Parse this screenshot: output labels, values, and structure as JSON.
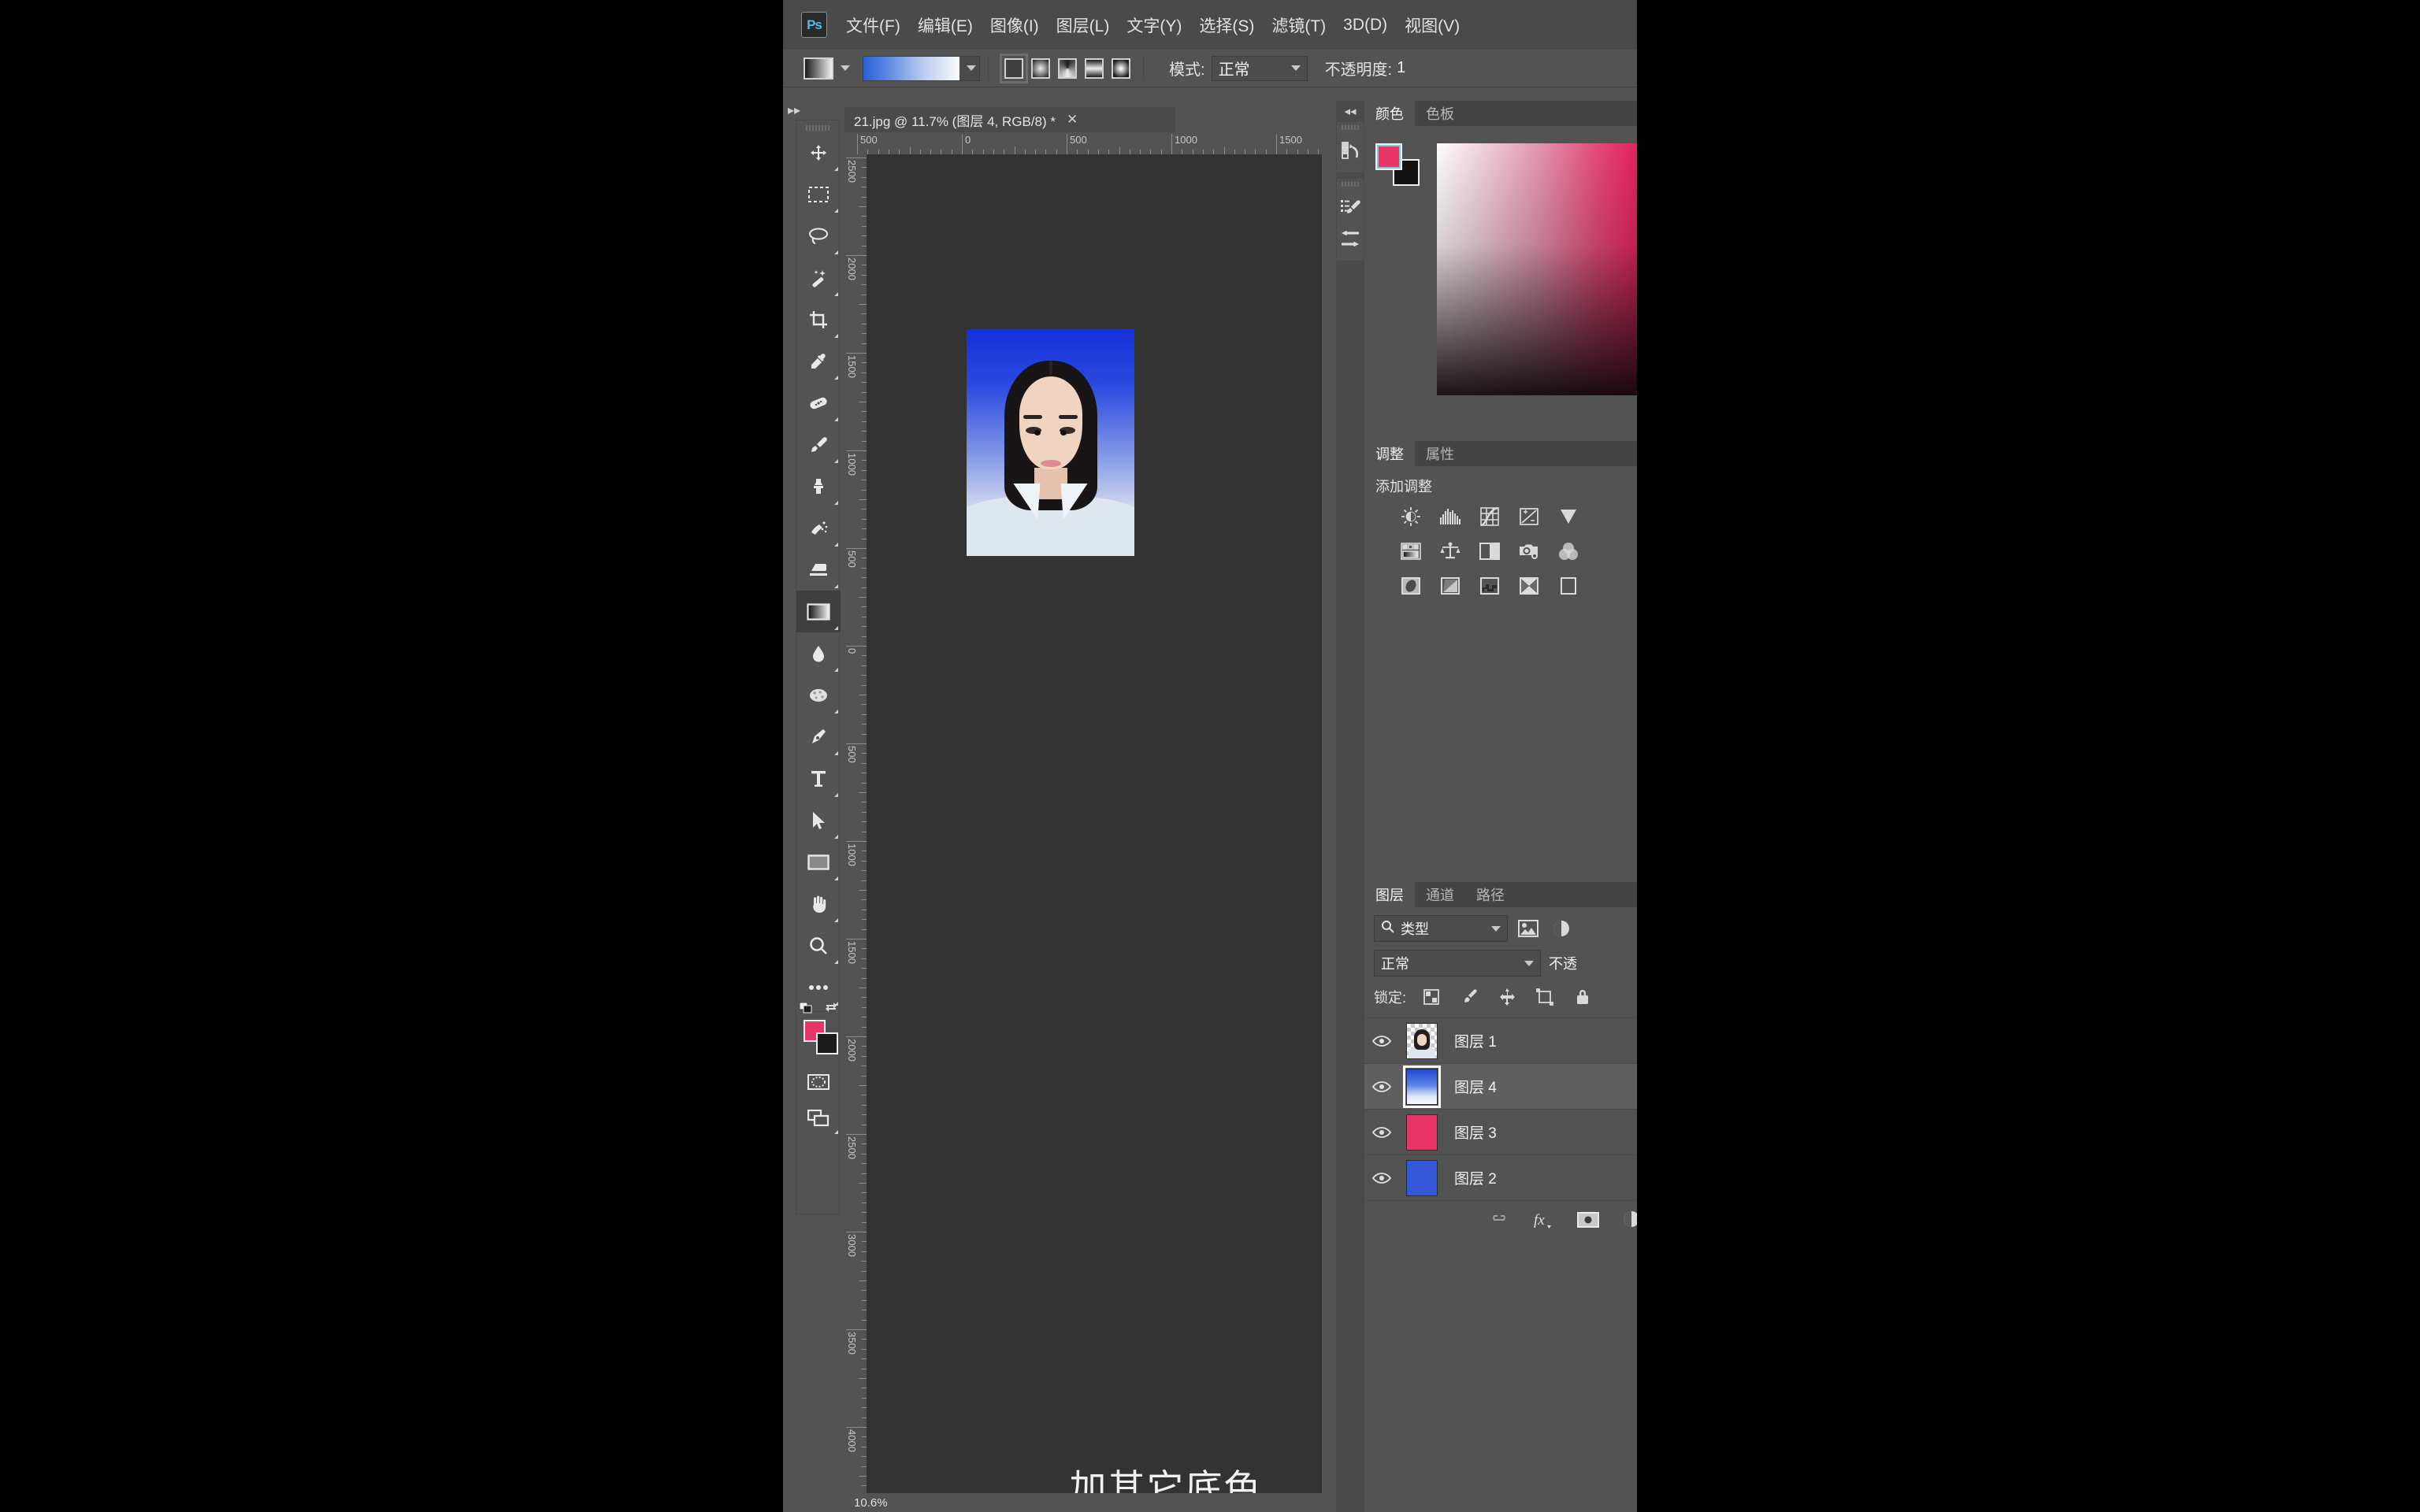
{
  "app": {
    "logo": "Ps",
    "accent": "#57b9ea"
  },
  "menu": {
    "items": [
      {
        "label": "文件(F)"
      },
      {
        "label": "编辑(E)"
      },
      {
        "label": "图像(I)"
      },
      {
        "label": "图层(L)"
      },
      {
        "label": "文字(Y)"
      },
      {
        "label": "选择(S)"
      },
      {
        "label": "滤镜(T)"
      },
      {
        "label": "3D(D)"
      },
      {
        "label": "视图(V)"
      }
    ]
  },
  "options_bar": {
    "gradient_preset_icon": "gradient-preset-swatch",
    "gradient_swatch_icon": "blue-to-white-gradient",
    "gradient_types": [
      {
        "name": "linear-gradient-type",
        "selected": true
      },
      {
        "name": "radial-gradient-type",
        "selected": false
      },
      {
        "name": "angle-gradient-type",
        "selected": false
      },
      {
        "name": "reflected-gradient-type",
        "selected": false
      },
      {
        "name": "diamond-gradient-type",
        "selected": false
      }
    ],
    "mode_label": "模式:",
    "mode_value": "正常",
    "opacity_label": "不透明度:",
    "opacity_value": "1"
  },
  "left_dock": {
    "collapse_icon": "expand-right-double-chevron"
  },
  "toolbox": {
    "tools": [
      {
        "name": "move-tool",
        "label": "移动工具"
      },
      {
        "name": "rectangular-marquee-tool",
        "label": "矩形选框工具"
      },
      {
        "name": "lasso-tool",
        "label": "套索工具"
      },
      {
        "name": "magic-wand-tool",
        "label": "快速选择工具"
      },
      {
        "name": "crop-tool",
        "label": "裁剪工具"
      },
      {
        "name": "eyedropper-tool",
        "label": "吸管工具"
      },
      {
        "name": "spot-healing-brush-tool",
        "label": "污点修复画笔工具"
      },
      {
        "name": "brush-tool",
        "label": "画笔工具"
      },
      {
        "name": "clone-stamp-tool",
        "label": "仿制图章工具"
      },
      {
        "name": "history-brush-tool",
        "label": "历史记录画笔工具"
      },
      {
        "name": "eraser-tool",
        "label": "橡皮擦工具"
      },
      {
        "name": "gradient-tool",
        "label": "渐变工具",
        "selected": true
      },
      {
        "name": "blur-tool",
        "label": "模糊工具"
      },
      {
        "name": "dodge-tool",
        "label": "减淡工具"
      },
      {
        "name": "pen-tool",
        "label": "钢笔工具"
      },
      {
        "name": "horizontal-type-tool",
        "label": "横排文字工具"
      },
      {
        "name": "path-selection-tool",
        "label": "路径选择工具"
      },
      {
        "name": "rectangle-tool",
        "label": "矩形工具"
      },
      {
        "name": "hand-tool",
        "label": "抓手工具"
      },
      {
        "name": "zoom-tool",
        "label": "缩放工具"
      },
      {
        "name": "edit-toolbar-tool",
        "label": "更多工具"
      }
    ],
    "default_colors_icon": "default-foreground-background-icon",
    "swap_colors_icon": "swap-foreground-background-icon",
    "foreground_color": "#e8366b",
    "background_color": "#1b1b1b",
    "quick_mask_icon": "quick-mask-mode-icon",
    "screen_mode_icon": "screen-mode-icon"
  },
  "document": {
    "tab_title": "21.jpg @ 11.7% (图层 4, RGB/8) *",
    "close_icon": "close-tab-icon",
    "zoom_status": "10.6%",
    "ruler_h_labels": [
      "500",
      "0",
      "500",
      "1000",
      "1500"
    ],
    "ruler_v_labels": [
      "2500",
      "2000",
      "1500",
      "1000",
      "500",
      "0",
      "500",
      "1000",
      "1500",
      "2000",
      "2500",
      "3000",
      "3500",
      "4000"
    ],
    "subtitle_text": "加其它底色"
  },
  "right_rail": {
    "collapse_icon": "collapse-panels-double-chevron",
    "buttons": [
      {
        "name": "history-panel-icon"
      },
      {
        "name": "brush-settings-panel-icon"
      },
      {
        "name": "brush-presets-panel-icon"
      }
    ]
  },
  "color_panel": {
    "tabs": [
      {
        "name": "tab-color",
        "label": "颜色",
        "active": true
      },
      {
        "name": "tab-swatches",
        "label": "色板",
        "active": false
      }
    ],
    "foreground_color": "#e8366b",
    "background_color": "#131313",
    "ramp_icon": "color-ramp-picker"
  },
  "adjustments_panel": {
    "tabs": [
      {
        "name": "tab-adjustments",
        "label": "调整",
        "active": true
      },
      {
        "name": "tab-properties",
        "label": "属性",
        "active": false
      }
    ],
    "title": "添加调整",
    "icons": [
      [
        {
          "name": "brightness-contrast-icon"
        },
        {
          "name": "levels-icon"
        },
        {
          "name": "curves-icon"
        },
        {
          "name": "exposure-icon"
        },
        {
          "name": "vibrance-icon"
        }
      ],
      [
        {
          "name": "hue-saturation-icon"
        },
        {
          "name": "color-balance-icon"
        },
        {
          "name": "black-white-icon"
        },
        {
          "name": "photo-filter-icon"
        },
        {
          "name": "channel-mixer-icon"
        }
      ],
      [
        {
          "name": "invert-icon"
        },
        {
          "name": "posterize-icon"
        },
        {
          "name": "threshold-icon"
        },
        {
          "name": "gradient-map-icon"
        },
        {
          "name": "selective-color-icon"
        }
      ]
    ]
  },
  "layers_panel": {
    "tabs": [
      {
        "name": "tab-layers",
        "label": "图层",
        "active": true
      },
      {
        "name": "tab-channels",
        "label": "通道",
        "active": false
      },
      {
        "name": "tab-paths",
        "label": "路径",
        "active": false
      }
    ],
    "filter": {
      "search_icon": "search-icon",
      "type_value": "类型",
      "chevron_icon": "chevron-down-icon",
      "pixel_filter_icon": "pixel-layer-filter-icon",
      "adjustment_filter_icon": "adjustment-layer-filter-icon"
    },
    "blend": {
      "mode_value": "正常",
      "chevron_icon": "chevron-down-icon",
      "opacity_label": "不透"
    },
    "lock": {
      "label": "锁定:",
      "icons": [
        {
          "name": "lock-transparent-pixels-icon"
        },
        {
          "name": "lock-image-pixels-icon"
        },
        {
          "name": "lock-position-icon"
        },
        {
          "name": "lock-artboard-icon"
        },
        {
          "name": "lock-all-icon"
        }
      ]
    },
    "layers": [
      {
        "name": "图层 1",
        "visible": true,
        "thumb": "portrait-transparent",
        "selected": false
      },
      {
        "name": "图层 4",
        "visible": true,
        "thumb": "blue-white-gradient",
        "selected": true
      },
      {
        "name": "图层 3",
        "visible": true,
        "thumb": "pink-solid",
        "selected": false,
        "color": "#e8366b"
      },
      {
        "name": "图层 2",
        "visible": true,
        "thumb": "blue-solid",
        "selected": false,
        "color": "#3458d8"
      }
    ],
    "footer_icons": [
      {
        "name": "link-layers-icon"
      },
      {
        "name": "layer-style-fx-icon"
      },
      {
        "name": "add-layer-mask-icon"
      },
      {
        "name": "new-adjustment-layer-icon"
      }
    ]
  }
}
